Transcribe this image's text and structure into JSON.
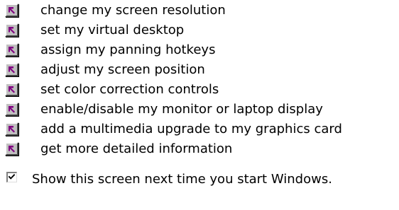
{
  "menu": {
    "items": [
      {
        "label": "change my screen resolution",
        "icon": "shortcut-arrow-icon"
      },
      {
        "label": "set my virtual desktop",
        "icon": "shortcut-arrow-icon"
      },
      {
        "label": "assign my panning hotkeys",
        "icon": "shortcut-arrow-icon"
      },
      {
        "label": "adjust my screen position",
        "icon": "shortcut-arrow-icon"
      },
      {
        "label": "set color correction controls",
        "icon": "shortcut-arrow-icon"
      },
      {
        "label": "enable/disable my monitor or laptop display",
        "icon": "shortcut-arrow-icon"
      },
      {
        "label": "add a multimedia upgrade to my graphics card",
        "icon": "shortcut-arrow-icon"
      },
      {
        "label": "get more detailed information",
        "icon": "shortcut-arrow-icon"
      }
    ]
  },
  "startup": {
    "checkbox_label": "Show this screen next time you start Windows.",
    "checked": true
  },
  "colors": {
    "icon_arrow": "#800080",
    "icon_face": "#c0c0c0"
  }
}
